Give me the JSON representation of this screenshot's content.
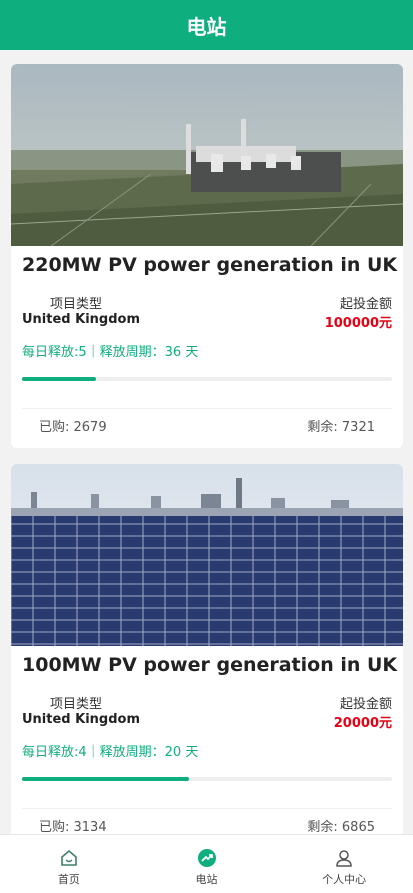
{
  "header": {
    "title": "电站"
  },
  "cards": [
    {
      "title": "220MW PV power generation in UK",
      "type_label": "项目类型",
      "amount_label": "起投金额",
      "country": "United Kingdom",
      "amount": "100000元",
      "release": "每日释放:5｜释放周期：36 天",
      "progress": 0.2,
      "bought": "已购: 2679",
      "remaining": "剩余: 7321"
    },
    {
      "title": "100MW PV power generation in UK",
      "type_label": "项目类型",
      "amount_label": "起投金额",
      "country": "United Kingdom",
      "amount": "20000元",
      "release": "每日释放:4｜释放周期：20 天",
      "progress": 0.45,
      "bought": "已购: 3134",
      "remaining": "剩余: 6865"
    }
  ],
  "tabbar": {
    "items": [
      {
        "label": "首页",
        "icon": "home-icon"
      },
      {
        "label": "电站",
        "icon": "trend-icon",
        "active": true
      },
      {
        "label": "个人中心",
        "icon": "user-icon"
      }
    ]
  },
  "colors": {
    "brand": "#0fae7e",
    "amount": "#e60012"
  }
}
